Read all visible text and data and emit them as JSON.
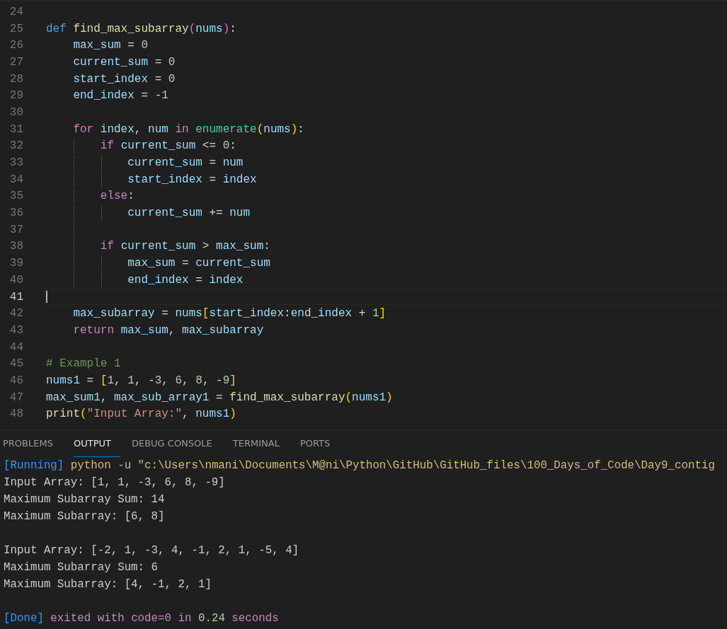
{
  "editor": {
    "lines": [
      {
        "number": "24",
        "current": false
      },
      {
        "number": "25",
        "current": false,
        "tokens": [
          {
            "kind": "kw",
            "t": "def "
          },
          {
            "kind": "fn",
            "t": "find_max_subarray"
          },
          {
            "kind": "br2",
            "t": "("
          },
          {
            "kind": "var",
            "t": "nums"
          },
          {
            "kind": "br2",
            "t": ")"
          },
          {
            "kind": "op",
            "t": ":"
          }
        ]
      },
      {
        "number": "26",
        "current": false,
        "tokens": [
          {
            "kind": "var",
            "t": "    max_sum"
          },
          {
            "kind": "op",
            "t": " = "
          },
          {
            "kind": "num",
            "t": "0"
          }
        ]
      },
      {
        "number": "27",
        "current": false,
        "tokens": [
          {
            "kind": "var",
            "t": "    current_sum"
          },
          {
            "kind": "op",
            "t": " = "
          },
          {
            "kind": "num",
            "t": "0"
          }
        ]
      },
      {
        "number": "28",
        "current": false,
        "tokens": [
          {
            "kind": "var",
            "t": "    start_index"
          },
          {
            "kind": "op",
            "t": " = "
          },
          {
            "kind": "num",
            "t": "0"
          }
        ]
      },
      {
        "number": "29",
        "current": false,
        "tokens": [
          {
            "kind": "var",
            "t": "    end_index"
          },
          {
            "kind": "op",
            "t": " = -"
          },
          {
            "kind": "num",
            "t": "1"
          }
        ]
      },
      {
        "number": "30",
        "current": false
      },
      {
        "number": "31",
        "current": false,
        "tokens": [
          {
            "kind": "ctl",
            "t": "    for "
          },
          {
            "kind": "var",
            "t": "index"
          },
          {
            "kind": "op",
            "t": ", "
          },
          {
            "kind": "var",
            "t": "num"
          },
          {
            "kind": "ctl",
            "t": " in "
          },
          {
            "kind": "cls",
            "t": "enumerate"
          },
          {
            "kind": "br1",
            "t": "("
          },
          {
            "kind": "var",
            "t": "nums"
          },
          {
            "kind": "br1",
            "t": ")"
          },
          {
            "kind": "op",
            "t": ":"
          }
        ]
      },
      {
        "number": "32",
        "current": false,
        "tokens": [
          {
            "kind": "ctl",
            "t": "        if "
          },
          {
            "kind": "var",
            "t": "current_sum"
          },
          {
            "kind": "op",
            "t": " <= "
          },
          {
            "kind": "num",
            "t": "0"
          },
          {
            "kind": "op",
            "t": ":"
          }
        ]
      },
      {
        "number": "33",
        "current": false,
        "tokens": [
          {
            "kind": "var",
            "t": "            current_sum"
          },
          {
            "kind": "op",
            "t": " = "
          },
          {
            "kind": "var",
            "t": "num"
          }
        ]
      },
      {
        "number": "34",
        "current": false,
        "tokens": [
          {
            "kind": "var",
            "t": "            start_index"
          },
          {
            "kind": "op",
            "t": " = "
          },
          {
            "kind": "var",
            "t": "index"
          }
        ]
      },
      {
        "number": "35",
        "current": false,
        "tokens": [
          {
            "kind": "ctl",
            "t": "        else"
          },
          {
            "kind": "op",
            "t": ":"
          }
        ]
      },
      {
        "number": "36",
        "current": false,
        "tokens": [
          {
            "kind": "var",
            "t": "            current_sum"
          },
          {
            "kind": "op",
            "t": " += "
          },
          {
            "kind": "var",
            "t": "num"
          }
        ]
      },
      {
        "number": "37",
        "current": false
      },
      {
        "number": "38",
        "current": false,
        "tokens": [
          {
            "kind": "ctl",
            "t": "        if "
          },
          {
            "kind": "var",
            "t": "current_sum"
          },
          {
            "kind": "op",
            "t": " > "
          },
          {
            "kind": "var",
            "t": "max_sum"
          },
          {
            "kind": "op",
            "t": ":"
          }
        ]
      },
      {
        "number": "39",
        "current": false,
        "tokens": [
          {
            "kind": "var",
            "t": "            max_sum"
          },
          {
            "kind": "op",
            "t": " = "
          },
          {
            "kind": "var",
            "t": "current_sum"
          }
        ]
      },
      {
        "number": "40",
        "current": false,
        "tokens": [
          {
            "kind": "var",
            "t": "            end_index"
          },
          {
            "kind": "op",
            "t": " = "
          },
          {
            "kind": "var",
            "t": "index"
          }
        ]
      },
      {
        "number": "41",
        "current": true
      },
      {
        "number": "42",
        "current": false,
        "tokens": [
          {
            "kind": "var",
            "t": "    max_subarray"
          },
          {
            "kind": "op",
            "t": " = "
          },
          {
            "kind": "var",
            "t": "nums"
          },
          {
            "kind": "br1",
            "t": "["
          },
          {
            "kind": "var",
            "t": "start_index"
          },
          {
            "kind": "op",
            "t": ":"
          },
          {
            "kind": "var",
            "t": "end_index"
          },
          {
            "kind": "op",
            "t": " + "
          },
          {
            "kind": "num",
            "t": "1"
          },
          {
            "kind": "br1",
            "t": "]"
          }
        ]
      },
      {
        "number": "43",
        "current": false,
        "tokens": [
          {
            "kind": "ctl",
            "t": "    return "
          },
          {
            "kind": "var",
            "t": "max_sum"
          },
          {
            "kind": "op",
            "t": ", "
          },
          {
            "kind": "var",
            "t": "max_subarray"
          }
        ]
      },
      {
        "number": "44",
        "current": false
      },
      {
        "number": "45",
        "current": false,
        "tokens": [
          {
            "kind": "cmt",
            "t": "# Example 1"
          }
        ]
      },
      {
        "number": "46",
        "current": false,
        "tokens": [
          {
            "kind": "var",
            "t": "nums1"
          },
          {
            "kind": "op",
            "t": " = "
          },
          {
            "kind": "br1",
            "t": "["
          },
          {
            "kind": "num",
            "t": "1"
          },
          {
            "kind": "op",
            "t": ", "
          },
          {
            "kind": "num",
            "t": "1"
          },
          {
            "kind": "op",
            "t": ", -"
          },
          {
            "kind": "num",
            "t": "3"
          },
          {
            "kind": "op",
            "t": ", "
          },
          {
            "kind": "num",
            "t": "6"
          },
          {
            "kind": "op",
            "t": ", "
          },
          {
            "kind": "num",
            "t": "8"
          },
          {
            "kind": "op",
            "t": ", -"
          },
          {
            "kind": "num",
            "t": "9"
          },
          {
            "kind": "br1",
            "t": "]"
          }
        ]
      },
      {
        "number": "47",
        "current": false,
        "tokens": [
          {
            "kind": "var",
            "t": "max_sum1"
          },
          {
            "kind": "op",
            "t": ", "
          },
          {
            "kind": "var",
            "t": "max_sub_array1"
          },
          {
            "kind": "op",
            "t": " = "
          },
          {
            "kind": "fn",
            "t": "find_max_subarray"
          },
          {
            "kind": "br1",
            "t": "("
          },
          {
            "kind": "var",
            "t": "nums1"
          },
          {
            "kind": "br1",
            "t": ")"
          }
        ]
      },
      {
        "number": "48",
        "current": false,
        "tokens": [
          {
            "kind": "fn",
            "t": "print"
          },
          {
            "kind": "br1",
            "t": "("
          },
          {
            "kind": "str",
            "t": "\"Input Array:\""
          },
          {
            "kind": "op",
            "t": ", "
          },
          {
            "kind": "var",
            "t": "nums1"
          },
          {
            "kind": "br1",
            "t": ")"
          }
        ]
      }
    ]
  },
  "panel": {
    "tabs": [
      {
        "label": "PROBLEMS",
        "selected": false
      },
      {
        "label": "OUTPUT",
        "selected": true
      },
      {
        "label": "DEBUG CONSOLE",
        "selected": false
      },
      {
        "label": "TERMINAL",
        "selected": false
      },
      {
        "label": "PORTS",
        "selected": false
      }
    ],
    "output": [
      {
        "lines": [
          [
            {
              "kind": "tag",
              "t": "[Running]"
            },
            {
              "kind": "cmd",
              "t": " python -u \"c:\\Users\\nmani\\Documents\\M@ni\\Python\\GitHub\\GitHub_files\\100_Days_of_Code\\Day9_contig"
            }
          ],
          [
            {
              "kind": "plain",
              "t": "Input Array: [1, 1, -3, 6, 8, -9]"
            }
          ],
          [
            {
              "kind": "plain",
              "t": "Maximum Subarray Sum: 14"
            }
          ],
          [
            {
              "kind": "plain",
              "t": "Maximum Subarray: [6, 8]"
            }
          ]
        ]
      },
      {
        "lines": [
          [
            {
              "kind": "plain",
              "t": "Input Array: [-2, 1, -3, 4, -1, 2, 1, -5, 4]"
            }
          ],
          [
            {
              "kind": "plain",
              "t": "Maximum Subarray Sum: 6"
            }
          ],
          [
            {
              "kind": "plain",
              "t": "Maximum Subarray: [4, -1, 2, 1]"
            }
          ]
        ]
      },
      {
        "lines": [
          [
            {
              "kind": "tag",
              "t": "[Done]"
            },
            {
              "kind": "ctl",
              "t": " exited with "
            },
            {
              "kind": "ctl",
              "t": "code=0"
            },
            {
              "kind": "ctl",
              "t": " in "
            },
            {
              "kind": "num",
              "t": "0.24"
            },
            {
              "kind": "ctl",
              "t": " seconds"
            }
          ]
        ]
      }
    ]
  }
}
